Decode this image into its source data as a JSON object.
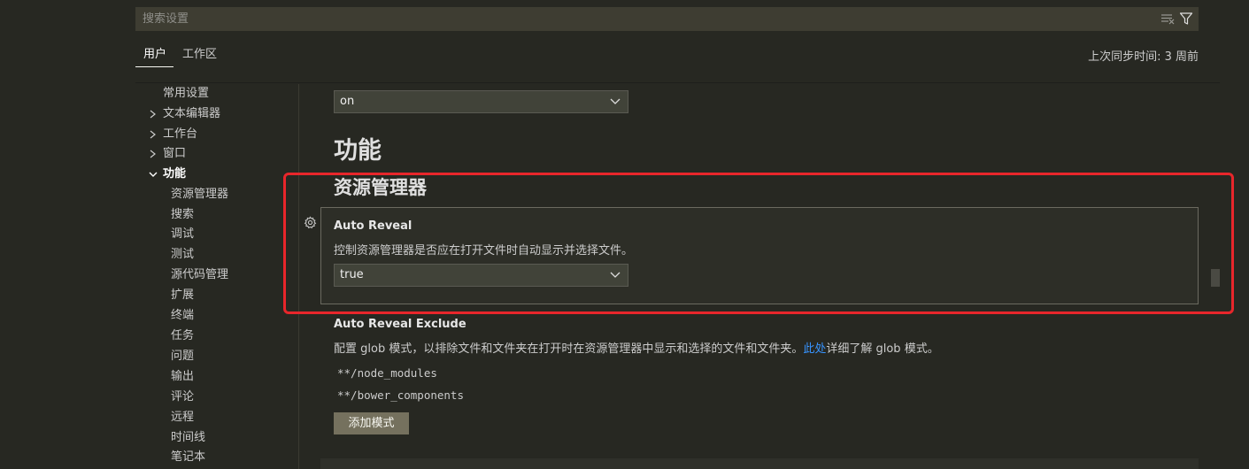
{
  "search": {
    "placeholder": "搜索设置"
  },
  "tabs": {
    "user": "用户",
    "workspace": "工作区"
  },
  "sync_status": "上次同步时间: 3 周前",
  "toc": [
    {
      "label": "常用设置",
      "chevron": "none",
      "bold": false
    },
    {
      "label": "文本编辑器",
      "chevron": "right",
      "bold": false
    },
    {
      "label": "工作台",
      "chevron": "right",
      "bold": false
    },
    {
      "label": "窗口",
      "chevron": "right",
      "bold": false
    },
    {
      "label": "功能",
      "chevron": "down",
      "bold": true
    },
    {
      "label": "资源管理器",
      "chevron": "none",
      "bold": false
    },
    {
      "label": "搜索",
      "chevron": "none",
      "bold": false
    },
    {
      "label": "调试",
      "chevron": "none",
      "bold": false
    },
    {
      "label": "测试",
      "chevron": "none",
      "bold": false
    },
    {
      "label": "源代码管理",
      "chevron": "none",
      "bold": false
    },
    {
      "label": "扩展",
      "chevron": "none",
      "bold": false
    },
    {
      "label": "终端",
      "chevron": "none",
      "bold": false
    },
    {
      "label": "任务",
      "chevron": "none",
      "bold": false
    },
    {
      "label": "问题",
      "chevron": "none",
      "bold": false
    },
    {
      "label": "输出",
      "chevron": "none",
      "bold": false
    },
    {
      "label": "评论",
      "chevron": "none",
      "bold": false
    },
    {
      "label": "远程",
      "chevron": "none",
      "bold": false
    },
    {
      "label": "时间线",
      "chevron": "none",
      "bold": false
    },
    {
      "label": "笔记本",
      "chevron": "none",
      "bold": false
    }
  ],
  "settings": {
    "top_dropdown_value": "on",
    "section_title": "功能",
    "subsection_title": "资源管理器",
    "auto_reveal": {
      "title": "Auto Reveal",
      "description": "控制资源管理器是否应在打开文件时自动显示并选择文件。",
      "value": "true"
    },
    "auto_reveal_exclude": {
      "title": "Auto Reveal Exclude",
      "description_before": "配置 glob 模式，以排除文件和文件夹在打开时在资源管理器中显示和选择的文件和文件夹。",
      "description_link": "此处",
      "description_after": "详细了解 glob 模式。",
      "patterns": [
        "**/node_modules",
        "**/bower_components"
      ],
      "add_button": "添加模式"
    }
  },
  "icons": {
    "search_actions": [
      "clear-filter-icon",
      "filter-icon"
    ],
    "setting_gear": "gear-icon",
    "dropdown_caret": "chevron-down-icon"
  },
  "colors": {
    "background": "#272822",
    "input_background": "#3e3d32",
    "highlight_border": "#e8262b",
    "link": "#3794ff",
    "button": "#75715e"
  }
}
